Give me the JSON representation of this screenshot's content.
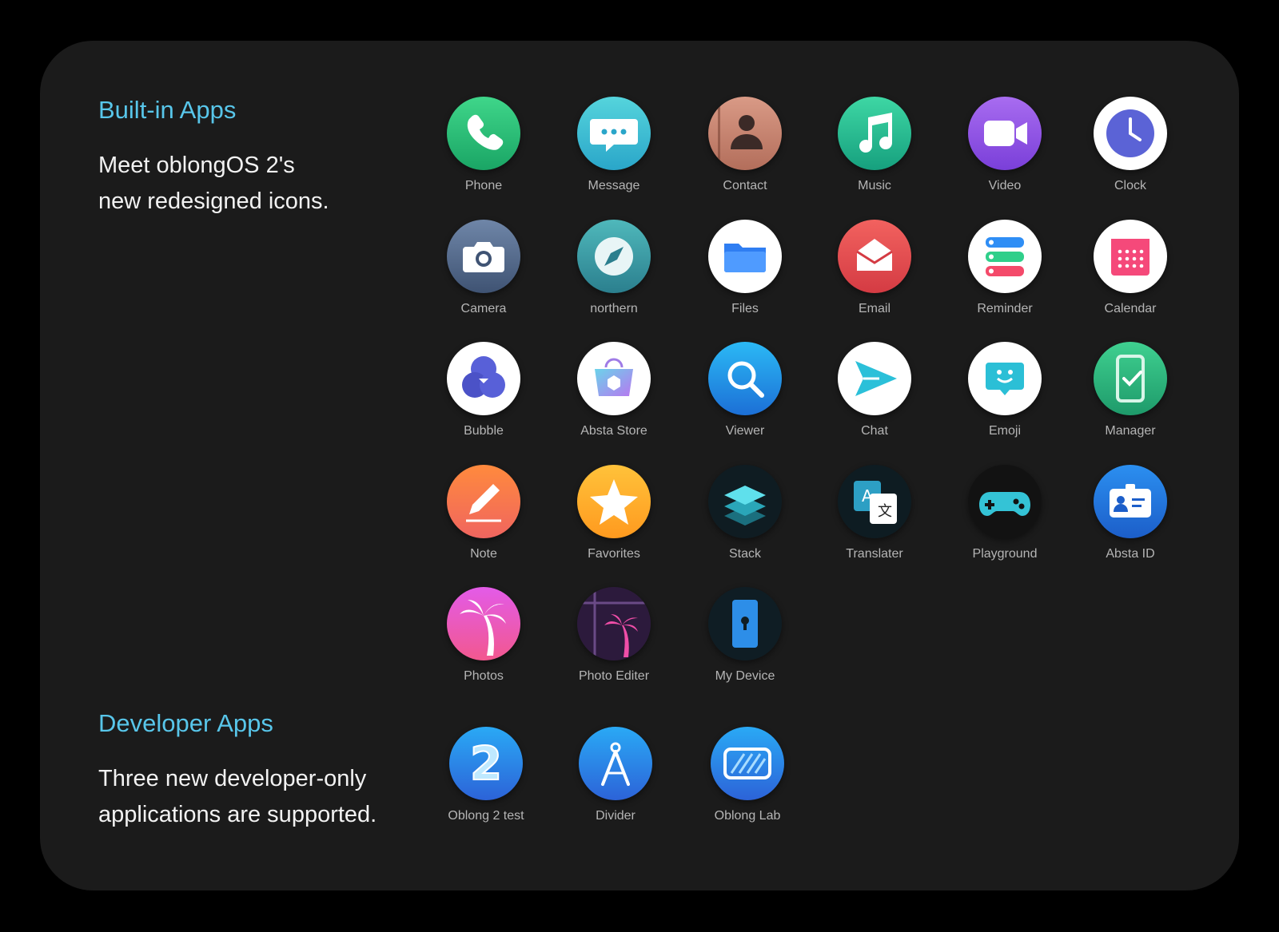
{
  "built_in": {
    "heading": "Built-in Apps",
    "desc_line1": "Meet oblongOS 2's",
    "desc_line2": "new redesigned icons.",
    "apps": [
      {
        "label": "Phone",
        "icon": "phone-icon"
      },
      {
        "label": "Message",
        "icon": "message-icon"
      },
      {
        "label": "Contact",
        "icon": "contact-icon"
      },
      {
        "label": "Music",
        "icon": "music-icon"
      },
      {
        "label": "Video",
        "icon": "video-icon"
      },
      {
        "label": "Clock",
        "icon": "clock-icon"
      },
      {
        "label": "Camera",
        "icon": "camera-icon"
      },
      {
        "label": "northern",
        "icon": "compass-icon"
      },
      {
        "label": "Files",
        "icon": "folder-icon"
      },
      {
        "label": "Email",
        "icon": "email-icon"
      },
      {
        "label": "Reminder",
        "icon": "reminder-icon"
      },
      {
        "label": "Calendar",
        "icon": "calendar-icon"
      },
      {
        "label": "Bubble",
        "icon": "bubble-icon"
      },
      {
        "label": "Absta Store",
        "icon": "store-bag-icon"
      },
      {
        "label": "Viewer",
        "icon": "magnifier-icon"
      },
      {
        "label": "Chat",
        "icon": "send-arrow-icon"
      },
      {
        "label": "Emoji",
        "icon": "emoji-icon"
      },
      {
        "label": "Manager",
        "icon": "phone-check-icon"
      },
      {
        "label": "Note",
        "icon": "pencil-icon"
      },
      {
        "label": "Favorites",
        "icon": "star-icon"
      },
      {
        "label": "Stack",
        "icon": "stack-icon"
      },
      {
        "label": "Translater",
        "icon": "translate-icon"
      },
      {
        "label": "Playground",
        "icon": "gamepad-icon"
      },
      {
        "label": "Absta ID",
        "icon": "id-card-icon"
      },
      {
        "label": "Photos",
        "icon": "palm-tree-icon"
      },
      {
        "label": "Photo Editer",
        "icon": "photo-editor-icon"
      },
      {
        "label": "My Device",
        "icon": "device-lock-icon"
      }
    ]
  },
  "developer": {
    "heading": "Developer Apps",
    "desc_line1": "Three new developer-only",
    "desc_line2": "applications are supported.",
    "apps": [
      {
        "label": "Oblong 2 test",
        "icon": "number-two-icon",
        "text": "2"
      },
      {
        "label": "Divider",
        "icon": "divider-compass-icon"
      },
      {
        "label": "Oblong Lab",
        "icon": "lab-screen-icon"
      }
    ]
  },
  "colors": {
    "accent": "#58c6ea",
    "panel": "#1b1b1b",
    "background": "#000000",
    "label": "#b5b5b5"
  }
}
